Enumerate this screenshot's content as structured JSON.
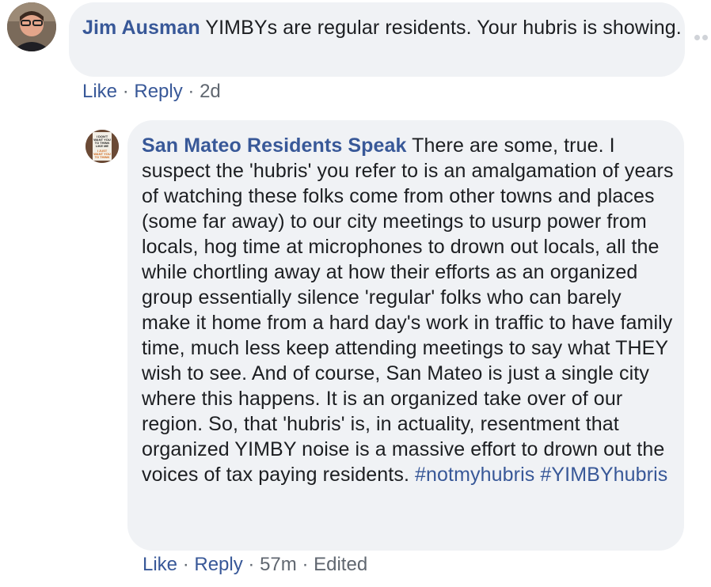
{
  "comment": {
    "author": "Jim Ausman",
    "text": " YIMBYs are regular residents. Your hubris is showing.",
    "actions": {
      "like": "Like",
      "reply": "Reply",
      "time": "2d"
    }
  },
  "reply": {
    "author": "San Mateo Residents Speak",
    "text": " There are some, true. I suspect the 'hubris' you refer to is an amalgamation of years of watching these folks come from other towns and places (some far away) to our city meetings to usurp power from locals, hog time at microphones to drown out locals, all the while chortling away at how their efforts as an organized group essentially silence 'regular' folks who can barely make it home from a hard day's work in traffic to have family time, much less keep attending meetings to say what THEY wish to see. And of course, San Mateo is just a single city where this happens. It is an organized take over of our region. So, that 'hubris' is, in actuality, resentment that organized YIMBY noise is a massive effort to drown out the voices of tax paying residents. ",
    "hashtags": [
      "#notmyhubris",
      "#YIMBYhubris"
    ],
    "avatar_text": [
      "I DON'T",
      "WANT YOU",
      "TO THINK",
      "LIKE ME",
      "I JUST",
      "WANT YOU",
      "TO THINK"
    ],
    "actions": {
      "like": "Like",
      "reply": "Reply",
      "time": "57m",
      "edited": "Edited"
    }
  },
  "icons": {
    "more": "more-options-icon"
  },
  "colors": {
    "link": "#385898",
    "bubble": "#f0f2f5",
    "meta": "#606770"
  }
}
